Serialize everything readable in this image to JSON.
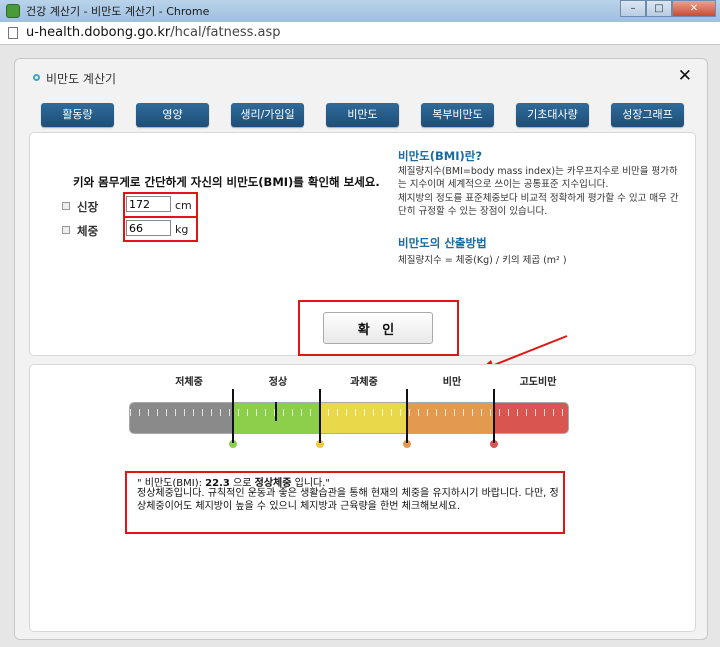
{
  "window": {
    "title": "건강 계산기 - 비만도 계산기 - Chrome",
    "url_domain": "u-health.dobong.go.kr",
    "url_path": "/hcal/fatness.asp"
  },
  "popup": {
    "title": "비만도 계산기",
    "close_label": "✕"
  },
  "tabs": [
    "활동량",
    "영양",
    "생리/가임일",
    "비만도",
    "복부비만도",
    "기초대사량",
    "성장그래프"
  ],
  "form": {
    "intro": "키와 몸무게로 간단하게 자신의 비만도(BMI)를 확인해 보세요.",
    "height_label": "신장",
    "height_value": "172",
    "height_unit": "cm",
    "weight_label": "체중",
    "weight_value": "66",
    "weight_unit": "kg",
    "confirm_label": "확 인"
  },
  "info": {
    "heading1": "비만도(BMI)란?",
    "text1": "체질량지수(BMI=body mass index)는 카우프지수로 비만을 평가하는 지수이며 세계적으로 쓰이는 공통표준 지수입니다.",
    "text2": "체지방의 정도를 표준체중보다 비교적 정확하게 평가할 수 있고 매우 간단히 규정할 수 있는 장점이 있습니다.",
    "heading2": "비만도의 산출방법",
    "formula": "체질량지수 = 체중(Kg) / 키의 제곱 (m² )"
  },
  "gauge": {
    "categories": [
      "저체중",
      "정상",
      "과체중",
      "비만",
      "고도비만"
    ],
    "dot_colors": [
      "#8ccf4a",
      "#f0c83a",
      "#e39a4e",
      "#d95550"
    ],
    "segment_colors": [
      "#8a8a8a",
      "#8ccf4a",
      "#e8d84a",
      "#e39a4e",
      "#d95550"
    ],
    "indicator_fraction": 0.335
  },
  "result": {
    "prefix": "\" 비만도(BMI): ",
    "bmi": "22.3",
    "middle": " 으로 ",
    "status": "정상체중",
    "suffix": " 입니다.\"",
    "message": "정상체중입니다. 규칙적인 운동과 좋은 생활습관을 통해 현재의 체중을 유지하시기 바랍니다. 다만, 정상체중이어도 체지방이 높을 수 있으니 체지방과 근육량을 한번 체크해보세요."
  }
}
